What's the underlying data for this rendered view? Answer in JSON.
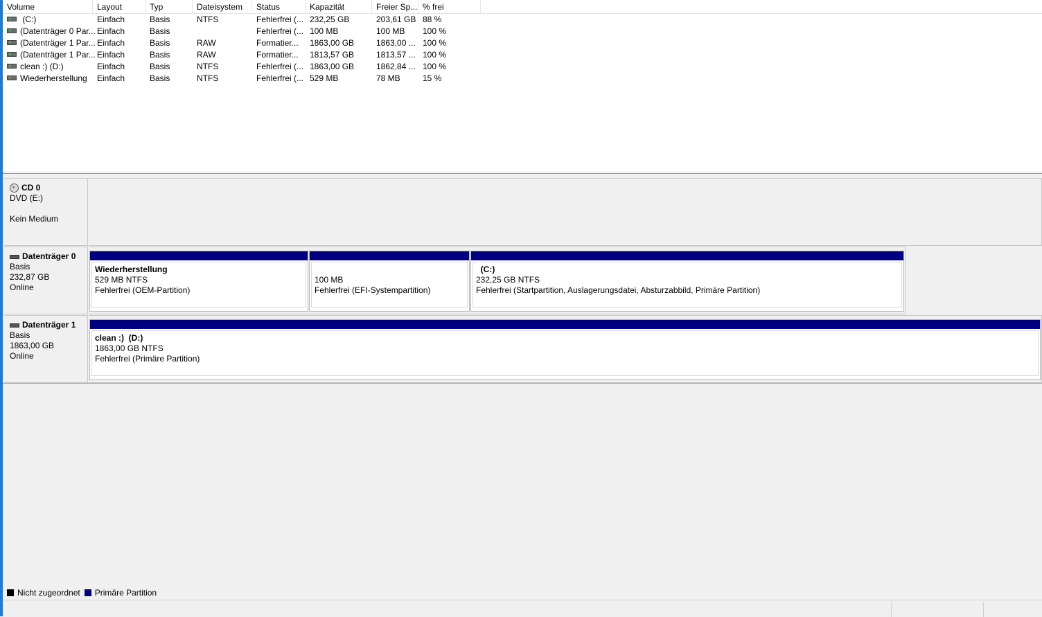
{
  "columns": [
    "Volume",
    "Layout",
    "Typ",
    "Dateisystem",
    "Status",
    "Kapazität",
    "Freier Sp...",
    "% frei"
  ],
  "volumes": [
    {
      "volume": " (C:)",
      "layout": "Einfach",
      "typ": "Basis",
      "fs": "NTFS",
      "status": "Fehlerfrei (...",
      "kap": "232,25 GB",
      "frei": "203,61 GB",
      "pct": "88 %"
    },
    {
      "volume": "(Datenträger 0 Par...",
      "layout": "Einfach",
      "typ": "Basis",
      "fs": "",
      "status": "Fehlerfrei (...",
      "kap": "100 MB",
      "frei": "100 MB",
      "pct": "100 %"
    },
    {
      "volume": "(Datenträger 1 Par...",
      "layout": "Einfach",
      "typ": "Basis",
      "fs": "RAW",
      "status": "Formatier...",
      "kap": "1863,00 GB",
      "frei": "1863,00 ...",
      "pct": "100 %"
    },
    {
      "volume": "(Datenträger 1 Par...",
      "layout": "Einfach",
      "typ": "Basis",
      "fs": "RAW",
      "status": "Formatier...",
      "kap": "1813,57 GB",
      "frei": "1813,57 ...",
      "pct": "100 %"
    },
    {
      "volume": "clean :) (D:)",
      "layout": "Einfach",
      "typ": "Basis",
      "fs": "NTFS",
      "status": "Fehlerfrei (...",
      "kap": "1863,00 GB",
      "frei": "1862,84 ...",
      "pct": "100 %"
    },
    {
      "volume": "Wiederherstellung",
      "layout": "Einfach",
      "typ": "Basis",
      "fs": "NTFS",
      "status": "Fehlerfrei (...",
      "kap": "529 MB",
      "frei": "78 MB",
      "pct": "15 %"
    }
  ],
  "cd0": {
    "title": "CD 0",
    "line1": "DVD (E:)",
    "line2": "Kein Medium"
  },
  "disk0": {
    "title": "Datenträger 0",
    "type": "Basis",
    "size": "232,87 GB",
    "state": "Online",
    "partitions": [
      {
        "name": "Wiederherstellung",
        "size": "529 MB NTFS",
        "status": "Fehlerfrei (OEM-Partition)"
      },
      {
        "name": "",
        "size": "100 MB",
        "status": "Fehlerfrei (EFI-Systempartition)"
      },
      {
        "name": "  (C:)",
        "size": "232,25 GB NTFS",
        "status": "Fehlerfrei (Startpartition, Auslagerungsdatei, Absturzabbild, Primäre Partition)"
      }
    ]
  },
  "disk1": {
    "title": "Datenträger 1",
    "type": "Basis",
    "size": "1863,00 GB",
    "state": "Online",
    "partitions": [
      {
        "name": "clean :)  (D:)",
        "size": "1863,00 GB NTFS",
        "status": "Fehlerfrei (Primäre Partition)"
      }
    ]
  },
  "legend": [
    {
      "label": "Nicht zugeordnet",
      "color": "#000000"
    },
    {
      "label": "Primäre Partition",
      "color": "#000080"
    }
  ]
}
